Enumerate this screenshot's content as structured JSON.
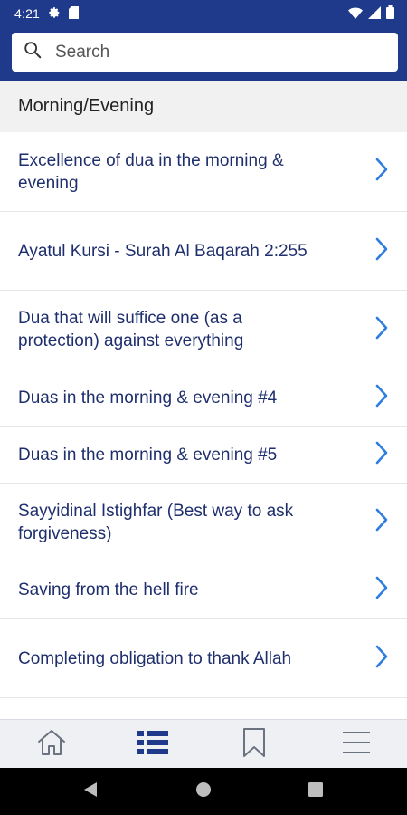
{
  "status_bar": {
    "time": "4:21",
    "icons": [
      "gear-icon",
      "sim-card-icon",
      "wifi-icon",
      "signal-icon",
      "battery-icon"
    ]
  },
  "search": {
    "placeholder": "Search",
    "value": ""
  },
  "section": {
    "title": "Morning/Evening"
  },
  "list": {
    "items": [
      {
        "label": "Excellence of dua in the morning & evening"
      },
      {
        "label": "Ayatul Kursi - Surah Al Baqarah 2:255"
      },
      {
        "label": "Dua that will suffice one (as a protection) against everything"
      },
      {
        "label": "Duas in the morning & evening #4"
      },
      {
        "label": "Duas in the morning & evening #5"
      },
      {
        "label": "Sayyidinal Istighfar (Best way to ask forgiveness)"
      },
      {
        "label": "Saving from the hell fire"
      },
      {
        "label": "Completing obligation to thank Allah"
      }
    ]
  },
  "bottom_nav": {
    "items": [
      {
        "icon": "home-icon",
        "active": false
      },
      {
        "icon": "list-icon",
        "active": true
      },
      {
        "icon": "bookmark-icon",
        "active": false
      },
      {
        "icon": "menu-icon",
        "active": false
      }
    ]
  },
  "colors": {
    "primary": "#1f3a8a",
    "item_text": "#1f2f6e",
    "chevron": "#2f7de1",
    "section_bg": "#f1f1f1",
    "nav_bg": "#eef0f3",
    "nav_inactive": "#6b7280"
  }
}
